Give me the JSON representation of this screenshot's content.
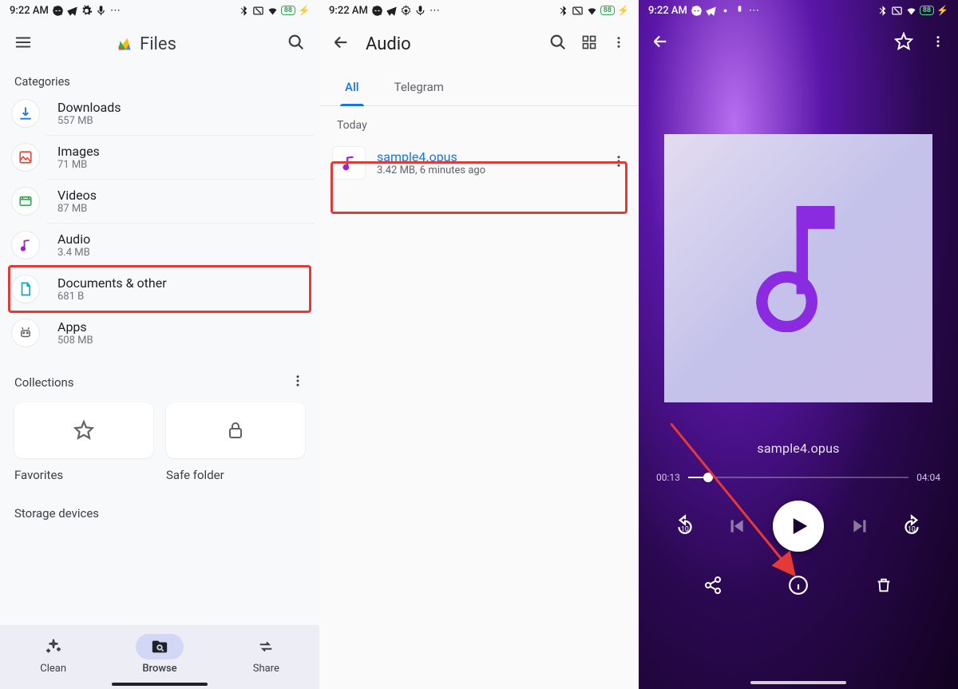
{
  "status": {
    "time": "9:22 AM",
    "battery": "88"
  },
  "screen1": {
    "app_title": "Files",
    "section_categories": "Categories",
    "categories": [
      {
        "name": "Downloads",
        "sub": "557 MB"
      },
      {
        "name": "Images",
        "sub": "71 MB"
      },
      {
        "name": "Videos",
        "sub": "87 MB"
      },
      {
        "name": "Audio",
        "sub": "3.4 MB"
      },
      {
        "name": "Documents & other",
        "sub": "681 B"
      },
      {
        "name": "Apps",
        "sub": "508 MB"
      }
    ],
    "section_collections": "Collections",
    "collections": {
      "favorites": "Favorites",
      "safefolder": "Safe folder"
    },
    "section_storage": "Storage devices",
    "nav": {
      "clean": "Clean",
      "browse": "Browse",
      "share": "Share"
    }
  },
  "screen2": {
    "title": "Audio",
    "tabs": {
      "all": "All",
      "telegram": "Telegram"
    },
    "date_header": "Today",
    "file": {
      "name": "sample4.opus",
      "meta": "3.42 MB, 6 minutes ago"
    }
  },
  "screen3": {
    "track_title": "sample4.opus",
    "time_elapsed": "00:13",
    "time_total": "04:04"
  }
}
